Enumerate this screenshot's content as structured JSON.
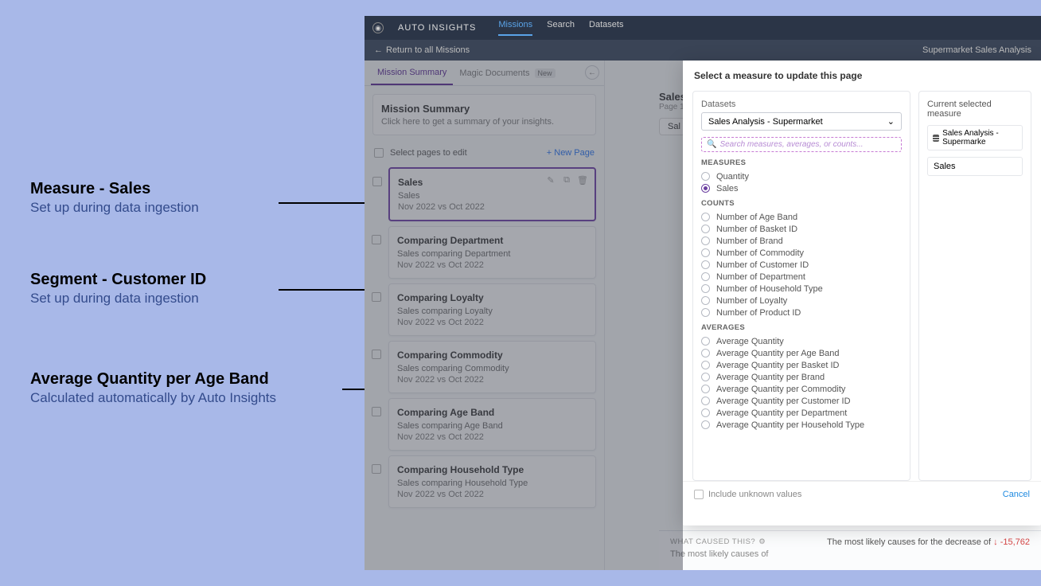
{
  "annotations": {
    "measure": {
      "title": "Measure - Sales",
      "sub": "Set up during data ingestion"
    },
    "segment": {
      "title": "Segment - Customer ID",
      "sub": "Set up during data ingestion"
    },
    "average": {
      "title": "Average Quantity per Age Band",
      "sub": "Calculated automatically by Auto Insights"
    }
  },
  "app": {
    "brand": "AUTO INSIGHTS",
    "nav": {
      "missions": "Missions",
      "search": "Search",
      "datasets": "Datasets"
    },
    "return": "Return to all Missions",
    "breadcrumb": "Supermarket Sales Analysis"
  },
  "tabs": {
    "summary": "Mission Summary",
    "magic": "Magic Documents",
    "magic_badge": "New"
  },
  "summary_box": {
    "title": "Mission Summary",
    "text": "Click here to get a summary of your insights."
  },
  "select_pages_label": "Select pages to edit",
  "new_page_label": "+  New Page",
  "cards": [
    {
      "title": "Sales",
      "sub": "Sales",
      "dates": "Nov 2022 vs Oct 2022"
    },
    {
      "title": "Comparing Department",
      "sub": "Sales comparing Department",
      "dates": "Nov 2022 vs Oct 2022"
    },
    {
      "title": "Comparing Loyalty",
      "sub": "Sales comparing Loyalty",
      "dates": "Nov 2022 vs Oct 2022"
    },
    {
      "title": "Comparing Commodity",
      "sub": "Sales comparing Commodity",
      "dates": "Nov 2022 vs Oct 2022"
    },
    {
      "title": "Comparing Age Band",
      "sub": "Sales comparing Age Band",
      "dates": "Nov 2022 vs Oct 2022"
    },
    {
      "title": "Comparing Household Type",
      "sub": "Sales comparing Household Type",
      "dates": "Nov 2022 vs Oct 2022"
    }
  ],
  "mid": {
    "title": "Sales",
    "page_of": "Page 1",
    "pill": "Sal"
  },
  "modal": {
    "header": "Select a measure to update this page",
    "datasets_label": "Datasets",
    "dataset_value": "Sales Analysis - Supermarket",
    "search_placeholder": "Search measures, averages, or counts...",
    "groups": {
      "measures_head": "MEASURES",
      "counts_head": "COUNTS",
      "averages_head": "AVERAGES"
    },
    "measures": [
      "Quantity",
      "Sales"
    ],
    "measures_selected": "Sales",
    "counts": [
      "Number of Age Band",
      "Number of Basket ID",
      "Number of Brand",
      "Number of Commodity",
      "Number of Customer ID",
      "Number of Department",
      "Number of Household Type",
      "Number of Loyalty",
      "Number of Product ID"
    ],
    "averages": [
      "Average Quantity",
      "Average Quantity per Age Band",
      "Average Quantity per Basket ID",
      "Average Quantity per Brand",
      "Average Quantity per Commodity",
      "Average Quantity per Customer ID",
      "Average Quantity per Department",
      "Average Quantity per Household Type"
    ],
    "current_label": "Current selected measure",
    "current_dataset": "Sales Analysis - Supermarke",
    "current_measure": "Sales",
    "include_unknown": "Include unknown values",
    "cancel": "Cancel"
  },
  "cause": {
    "head": "WHAT CAUSED THIS?",
    "left_text": "The most likely causes of",
    "right_prefix": "The most likely causes for the decrease of ",
    "right_value": "-15,762"
  }
}
